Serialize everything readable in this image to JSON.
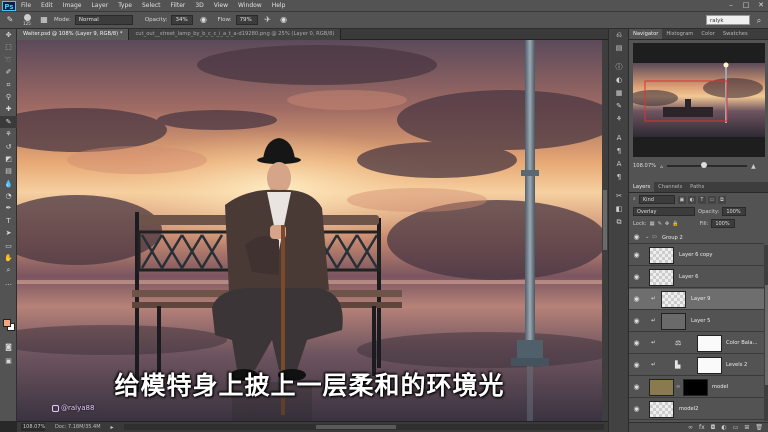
{
  "menubar": {
    "logo": "Ps",
    "items": [
      "File",
      "Edit",
      "Image",
      "Layer",
      "Type",
      "Select",
      "Filter",
      "3D",
      "View",
      "Window",
      "Help"
    ],
    "window_controls": [
      "–",
      "□",
      "✕"
    ]
  },
  "options": {
    "brush_size": "125",
    "mode_label": "Mode:",
    "mode_value": "Normal",
    "opacity_label": "Opacity:",
    "opacity_value": "34%",
    "flow_label": "Flow:",
    "flow_value": "79%",
    "workspace": "ralyk"
  },
  "doc_tabs": [
    "Waiter.psd @ 108% (Layer 9, RGB/8) *",
    "cut_out__street_lamp_by_b_c_c_i_a_t_a-d19280.png @ 25% (Layer 0, RGB/8)"
  ],
  "status": {
    "zoom": "108.07%",
    "doc": "Doc: 7.18M/35.4M"
  },
  "subtitle": "给模特身上披上一层柔和的环境光",
  "watermark": "@ralya88",
  "panels": {
    "top_tabs": [
      "Navigator",
      "Histogram",
      "Color",
      "Swatches"
    ],
    "nav_zoom": "108.07%",
    "layer_tabs": [
      "Layers",
      "Channels",
      "Paths"
    ],
    "kind_label": "Kind",
    "blend_mode": "Overlay",
    "opacity_label": "Opacity:",
    "opacity_value": "100%",
    "lock_label": "Lock:",
    "fill_label": "Fill:",
    "fill_value": "100%",
    "layers": [
      {
        "name": "Group 2"
      },
      {
        "name": "Layer 6 copy"
      },
      {
        "name": "Layer 6"
      },
      {
        "name": "Layer 9"
      },
      {
        "name": "Layer 5"
      },
      {
        "name": "Color Bala..."
      },
      {
        "name": "Levels 2"
      },
      {
        "name": "model"
      },
      {
        "name": "model2"
      }
    ]
  },
  "colors": {
    "foreground": "#f0a880",
    "background": "#ffffff",
    "accent": "#4ec2ff"
  }
}
